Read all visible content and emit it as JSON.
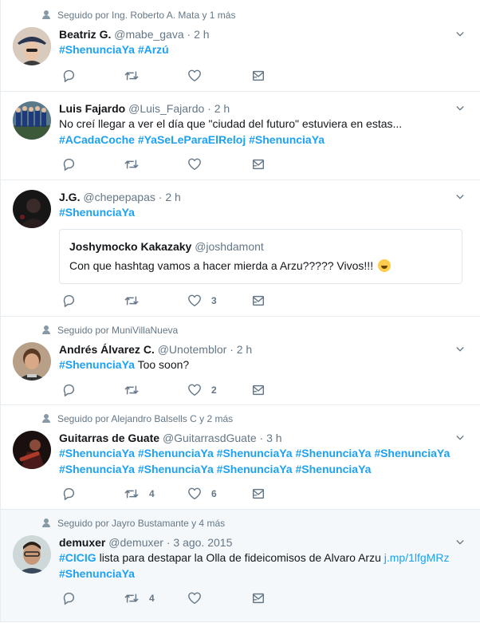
{
  "tweets": [
    {
      "context": "Seguido por Ing. Roberto A. Mata y 1 más",
      "name": "Beatriz G.",
      "handle": "@mabe_gava",
      "time": "2 h",
      "text_parts": [],
      "tags": [
        "#ShenunciaYa",
        "#Arzú"
      ],
      "retweets": "",
      "likes": ""
    },
    {
      "context": "",
      "name": "Luis Fajardo",
      "handle": "@Luis_Fajardo",
      "time": "2 h",
      "text": "No creí llegar a ver el día que \"ciudad del futuro\" estuviera en estas...",
      "tags": [
        "#ACadaCoche",
        "#YaSeLeParaElReloj",
        "#ShenunciaYa"
      ],
      "retweets": "",
      "likes": ""
    },
    {
      "context": "",
      "name": "J.G.",
      "handle": "@chepepapas",
      "time": "2 h",
      "tags": [
        "#ShenunciaYa"
      ],
      "quote": {
        "name": "Joshymocko Kakazaky",
        "handle": "@joshdamont",
        "text": "Con que hashtag vamos a hacer mierda a Arzu????? Vivos!!!"
      },
      "retweets": "",
      "likes": "3"
    },
    {
      "context": "Seguido por MuniVillaNueva",
      "name": "Andrés Álvarez C.",
      "handle": "@Unotemblor",
      "time": "2 h",
      "tags": [
        "#ShenunciaYa"
      ],
      "after_text": " Too soon?",
      "retweets": "",
      "likes": "2"
    },
    {
      "context": "Seguido por Alejandro Balsells C y 2 más",
      "name": "Guitarras de Guate",
      "handle": "@GuitarrasdGuate",
      "time": "3 h",
      "tags_line1": [
        "#ShenunciaYa",
        "#ShenunciaYa",
        "#ShenunciaYa",
        "#ShenunciaYa",
        "#ShenunciaYa"
      ],
      "tags_line2": [
        "#ShenunciaYa",
        "#ShenunciaYa",
        "#ShenunciaYa",
        "#ShenunciaYa"
      ],
      "retweets": "4",
      "likes": "6"
    },
    {
      "context": "Seguido por Jayro Bustamante y 4 más",
      "name": "demuxer",
      "handle": "@demuxer",
      "time": "3 ago. 2015",
      "lead_tag": "#CICIG",
      "text": " lista para destapar la Olla de fideicomisos de Alvaro Arzu ",
      "link": "j.mp/1lfgMRz",
      "tags": [
        "#ShenunciaYa"
      ],
      "retweets": "4",
      "likes": ""
    }
  ],
  "colors": {
    "link": "#1da1f2",
    "muted": "#657786",
    "border": "#e6ecf0",
    "highlight_bg": "#f5f8fa"
  },
  "icons": [
    "person-icon",
    "chevron-down-icon",
    "reply-icon",
    "retweet-icon",
    "heart-icon",
    "dm-icon",
    "emoji-laugh-icon"
  ]
}
